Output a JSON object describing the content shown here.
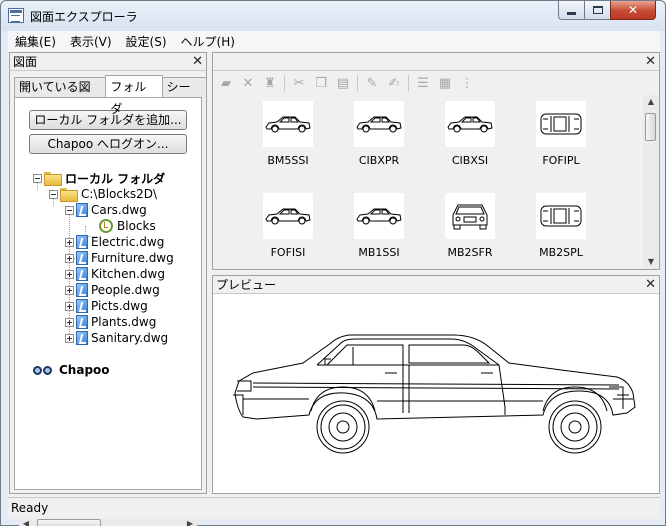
{
  "window": {
    "title": "図面エクスプローラ"
  },
  "menu": [
    {
      "label": "編集(E)"
    },
    {
      "label": "表示(V)"
    },
    {
      "label": "設定(S)"
    },
    {
      "label": "ヘルプ(H)"
    }
  ],
  "left_panel": {
    "title": "図面",
    "tabs": [
      {
        "label": "開いている図面",
        "active": false
      },
      {
        "label": "フォルダ",
        "active": true
      },
      {
        "label": "シート",
        "active": false
      }
    ],
    "add_local_folder_label": "ローカル フォルダを追加...",
    "chapoo_login_label": "Chapoo へログオン...",
    "tree": {
      "local_root": "ローカル フォルダ",
      "folder": "C:\\Blocks2D\\",
      "open_file": "Cars.dwg",
      "open_child": "Blocks",
      "files": [
        "Electric.dwg",
        "Furniture.dwg",
        "Kitchen.dwg",
        "People.dwg",
        "Picts.dwg",
        "Plants.dwg",
        "Sanitary.dwg"
      ],
      "chapoo_root": "Chapoo"
    }
  },
  "thumbnails": {
    "toolbar_icons": [
      "save-icon",
      "delete-icon",
      "stamp-icon",
      "cut-icon",
      "copy-icon",
      "paste-icon",
      "edit-icon",
      "properties-icon",
      "list-view-icon",
      "grid-view-icon",
      "tree-view-icon"
    ],
    "items": [
      {
        "name": "BM5SSI",
        "view": "side"
      },
      {
        "name": "CIBXPR",
        "view": "side"
      },
      {
        "name": "CIBXSI",
        "view": "side"
      },
      {
        "name": "FOFIPL",
        "view": "top"
      },
      {
        "name": "FOFISI",
        "view": "side"
      },
      {
        "name": "MB1SSI",
        "view": "side"
      },
      {
        "name": "MB2SFR",
        "view": "front"
      },
      {
        "name": "MB2SPL",
        "view": "top"
      }
    ]
  },
  "preview": {
    "title": "プレビュー"
  },
  "status": {
    "text": "Ready"
  }
}
